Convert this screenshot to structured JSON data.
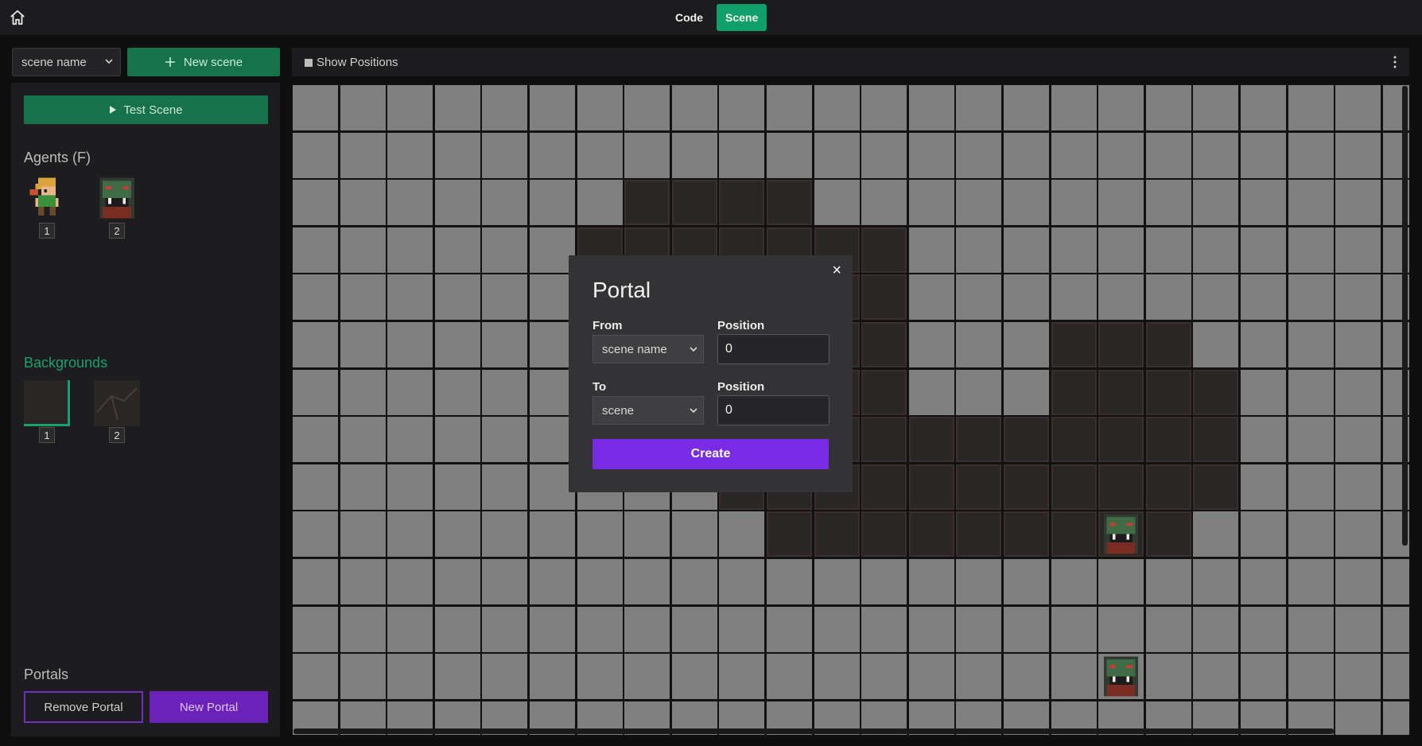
{
  "topbar": {
    "home_icon": "home-icon",
    "tabs": [
      {
        "label": "Code",
        "active": false
      },
      {
        "label": "Scene",
        "active": true
      }
    ],
    "accent": "#0f9f6b"
  },
  "scene_controls": {
    "scene_select_value": "scene name",
    "new_scene_label": "New scene",
    "new_scene_icon": "plus-icon"
  },
  "sidebar": {
    "test_scene_label": "Test Scene",
    "test_scene_icon": "play-icon",
    "agents_title": "Agents (F)",
    "agents": [
      {
        "number": "1",
        "icon": "elf-hero-sprite"
      },
      {
        "number": "2",
        "icon": "orc-sprite"
      }
    ],
    "backgrounds_title": "Backgrounds",
    "backgrounds": [
      {
        "number": "1",
        "icon": "dark-floor-tile",
        "selected": true
      },
      {
        "number": "2",
        "icon": "cracked-floor-tile",
        "selected": false
      }
    ],
    "portals_title": "Portals",
    "remove_portal_label": "Remove Portal",
    "new_portal_label": "New Portal"
  },
  "canvas_toolbar": {
    "show_positions_label": "Show Positions",
    "show_positions_checked": false,
    "menu_icon": "kebab-menu-icon"
  },
  "grid": {
    "columns": 24,
    "rows": 14,
    "empty_color": "#808080",
    "floor_color": "#2b2626",
    "agent_sprite": "orc-sprite",
    "agent_cells": [
      [
        4,
        9
      ],
      [
        9,
        17
      ],
      [
        12,
        17
      ]
    ]
  },
  "portal_modal": {
    "title": "Portal",
    "close_icon": "close-icon",
    "from_label": "From",
    "from_value": "scene name",
    "from_position_label": "Position",
    "from_position_value": "0",
    "to_label": "To",
    "to_value": "scene",
    "to_position_label": "Position",
    "to_position_value": "0",
    "create_label": "Create",
    "create_color": "#7a2be6"
  }
}
